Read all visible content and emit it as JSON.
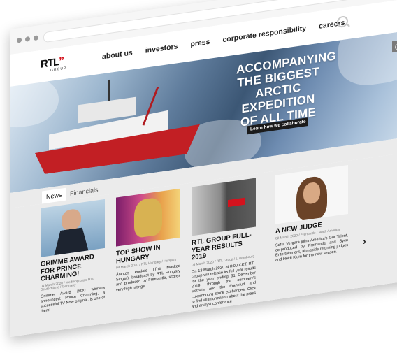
{
  "nav": {
    "logo_text": "RTL",
    "logo_quote": "”",
    "logo_sub": "GROUP",
    "items": [
      "about us",
      "investors",
      "press",
      "corporate responsibility",
      "careers"
    ]
  },
  "hero": {
    "headline_lines": [
      "ACCOMPANYING",
      "THE BIGGEST",
      "ARCTIC EXPEDITION",
      "OF ALL TIME"
    ],
    "cta": "Learn how we collaborate"
  },
  "tabs": [
    "News",
    "Financials"
  ],
  "cards": [
    {
      "title": "GRIMME AWARD FOR PRINCE CHARMING!",
      "meta": "04 March 2020 / Mediengruppe RTL Deutschland / Germany",
      "text": "Grimme Award 2020 winners announced: Prince Charming, a successful TV Now original, is one of them!"
    },
    {
      "title": "TOP SHOW IN HUNGARY",
      "meta": "04 March 2020 / RTL Hungary / Hungary",
      "text": "Álarcos énekes (The Masked Singer), broadcast by RTL Hungary and produced by Fremantle, scores very high ratings."
    },
    {
      "title": "RTL GROUP FULL-YEAR RESULTS 2019",
      "meta": "03 March 2020 / RTL Group / Luxembourg",
      "text": "On 13 March 2020 at 8:00 CET, RTL Group will release its full-year results for the year ending 31 December 2019, through the company's website and the Frankfurt and Luxembourg stock exchanges. Click to find all information about the press and analyst conference"
    },
    {
      "title": "A NEW JUDGE",
      "meta": "02 March 2020 / Fremantle / North America",
      "text": "Sofía Vergara joins America's Got Talent, co-produced by Fremantle and Syco Entertainment, alongside returning judges and Heidi Klum for the new season."
    }
  ],
  "colors": {
    "accent": "#d4121d",
    "tab_bg": "#ebebeb"
  }
}
